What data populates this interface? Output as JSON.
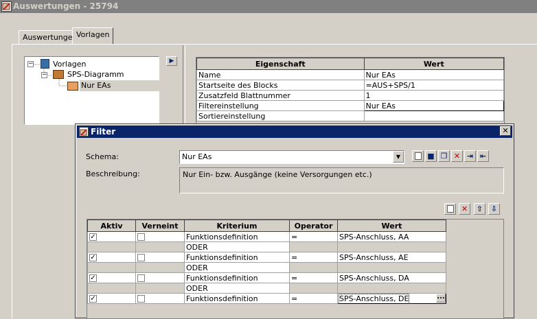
{
  "window": {
    "title": "Auswertungen - 25794"
  },
  "tabs": [
    {
      "label": "Auswertungen"
    },
    {
      "label": "Vorlagen"
    }
  ],
  "tree": {
    "root": "Vorlagen",
    "child": "SPS-Diagramm",
    "leaf": "Nur EAs",
    "expand_sign": "−"
  },
  "arrow_button": "▶",
  "properties": {
    "headers": [
      "Eigenschaft",
      "Wert"
    ],
    "rows": [
      {
        "name": "Name",
        "value": "Nur EAs"
      },
      {
        "name": "Startseite des Blocks",
        "value": "=AUS+SPS/1"
      },
      {
        "name": "Zusatzfeld Blattnummer",
        "value": "1"
      },
      {
        "name": "Filtereinstellung",
        "value": "Nur EAs"
      },
      {
        "name": "Sortiereinstellung",
        "value": ""
      }
    ]
  },
  "filter_dialog": {
    "title": "Filter",
    "close": "✕",
    "schema_label": "Schema:",
    "schema_value": "Nur EAs",
    "description_label": "Beschreibung:",
    "description_value": "Nur Ein- bzw. Ausgänge (keine Versorgungen etc.)",
    "grid": {
      "headers": [
        "Aktiv",
        "Verneint",
        "Kriterium",
        "Operator",
        "Wert"
      ],
      "rows": [
        {
          "aktiv": "✓",
          "verneint": "",
          "kriterium": "Funktionsdefinition",
          "operator": "=",
          "wert": "SPS-Anschluss, AA"
        },
        {
          "aktiv": "",
          "verneint": "",
          "kriterium": "ODER",
          "operator": "",
          "wert": ""
        },
        {
          "aktiv": "✓",
          "verneint": "",
          "kriterium": "Funktionsdefinition",
          "operator": "=",
          "wert": "SPS-Anschluss, AE"
        },
        {
          "aktiv": "",
          "verneint": "",
          "kriterium": "ODER",
          "operator": "",
          "wert": ""
        },
        {
          "aktiv": "✓",
          "verneint": "",
          "kriterium": "Funktionsdefinition",
          "operator": "=",
          "wert": "SPS-Anschluss, DA"
        },
        {
          "aktiv": "",
          "verneint": "",
          "kriterium": "ODER",
          "operator": "",
          "wert": ""
        },
        {
          "aktiv": "✓",
          "verneint": "",
          "kriterium": "Funktionsdefinition",
          "operator": "=",
          "wert": "SPS-Anschluss, DE"
        }
      ],
      "ellipsis": "..."
    }
  },
  "colors": {
    "titlebar_inactive": "#808080",
    "titlebar_active": "#0a246a",
    "face": "#d4d0c8"
  }
}
